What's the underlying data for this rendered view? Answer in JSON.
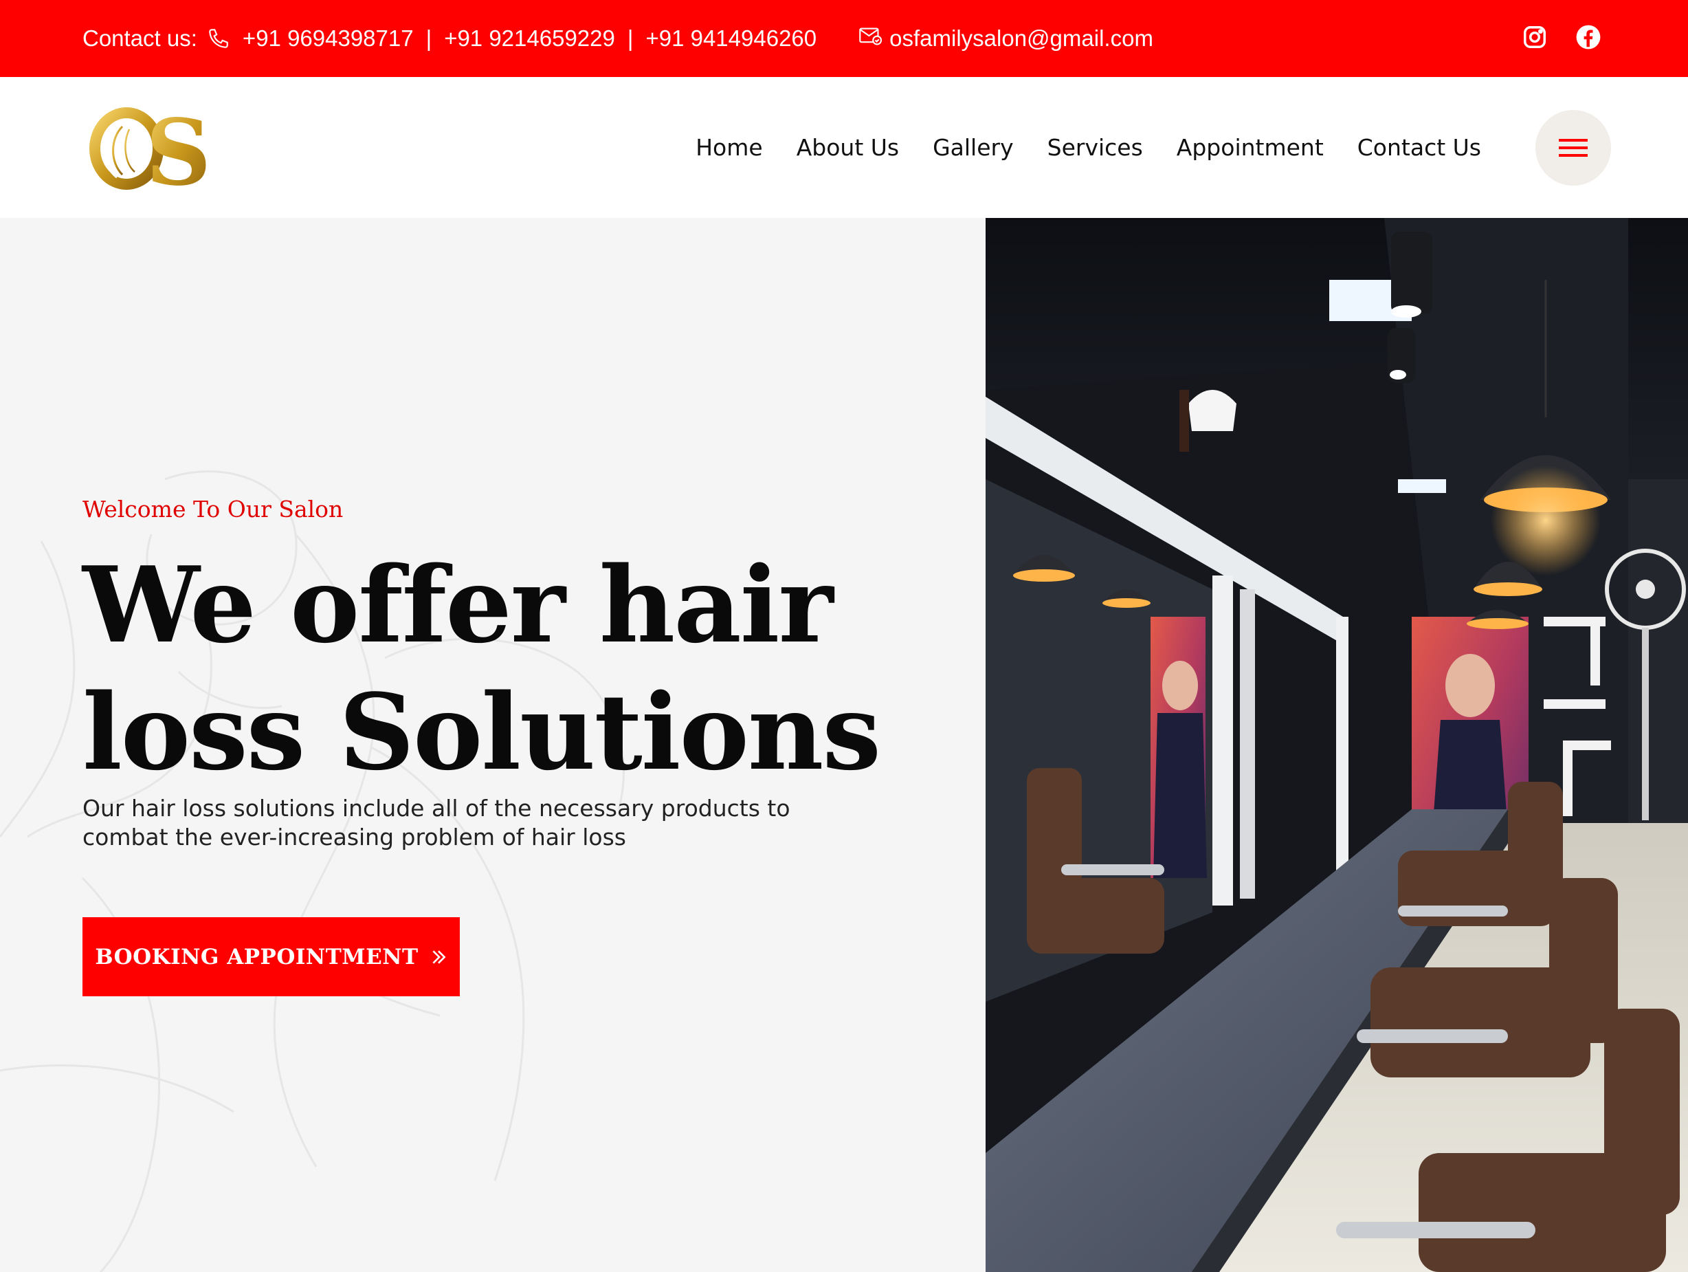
{
  "topbar": {
    "contact_label": "Contact us:",
    "phones": [
      "+91 9694398717",
      "+91 9214659229",
      "+91 9414946260"
    ],
    "separator": "|",
    "email": "osfamilysalon@gmail.com",
    "social": [
      "instagram-icon",
      "facebook-icon"
    ],
    "bg_color": "#ff0000"
  },
  "header": {
    "logo_text": "OS",
    "nav": [
      {
        "label": "Home"
      },
      {
        "label": "About Us"
      },
      {
        "label": "Gallery"
      },
      {
        "label": "Services"
      },
      {
        "label": "Appointment"
      },
      {
        "label": "Contact Us"
      }
    ],
    "menu_icon": "hamburger-icon"
  },
  "hero": {
    "eyebrow": "Welcome To Our Salon",
    "headline_line1": "We offer hair",
    "headline_line2": "loss Solutions",
    "lede": "Our hair loss solutions include all of the necessary products to combat the ever-increasing problem of hair loss",
    "cta_label": "BOOKING APPOINTMENT",
    "accent_color": "#ff0000"
  },
  "photo": {
    "subject": "salon interior photo"
  }
}
